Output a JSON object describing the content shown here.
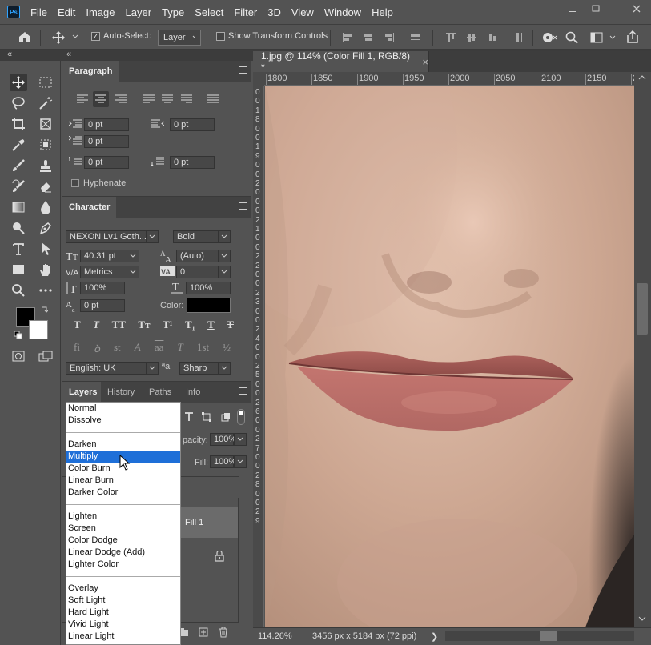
{
  "app": {
    "logo": "Ps",
    "accent": "#31a8ff"
  },
  "menubar": {
    "items": [
      "File",
      "Edit",
      "Image",
      "Layer",
      "Type",
      "Select",
      "Filter",
      "3D",
      "View",
      "Window",
      "Help"
    ]
  },
  "options": {
    "auto_select_label": "Auto-Select:",
    "auto_select_checked": true,
    "auto_select_target": "Layer",
    "show_transform_label": "Show Transform Controls",
    "show_transform_checked": false
  },
  "collapse": {
    "left": "«",
    "right": "«"
  },
  "document": {
    "tab_title": "1.jpg @ 114% (Color Fill 1, RGB/8) *",
    "close": "×"
  },
  "ruler": {
    "h_labels": [
      "1800",
      "1850",
      "1900",
      "1950",
      "2000",
      "2050",
      "2100",
      "2150",
      "2"
    ],
    "v_labels": [
      "0",
      "0",
      "1",
      "8",
      "0",
      "0",
      "1",
      "9",
      "0",
      "0",
      "2",
      "0",
      "0",
      "0",
      "2",
      "1",
      "0",
      "0",
      "2",
      "2",
      "0",
      "0",
      "2",
      "3",
      "0",
      "0",
      "2",
      "4",
      "0",
      "0",
      "2",
      "5",
      "0",
      "0",
      "2",
      "6",
      "0",
      "0",
      "2",
      "7",
      "0",
      "0",
      "2",
      "8",
      "0",
      "0",
      "2",
      "9"
    ]
  },
  "paragraph": {
    "tab": "Paragraph",
    "indent_left": "0 pt",
    "indent_right": "0 pt",
    "first_line": "0 pt",
    "space_before": "0 pt",
    "space_after": "0 pt",
    "hyphenate_label": "Hyphenate"
  },
  "character": {
    "tab": "Character",
    "font_family": "NEXON Lv1 Goth...",
    "font_style": "Bold",
    "size": "40.31 pt",
    "leading": "(Auto)",
    "kerning": "Metrics",
    "tracking": "0",
    "vscale": "100%",
    "hscale": "100%",
    "baseline": "0 pt",
    "color_label": "Color:",
    "color": "#000000",
    "language": "English: UK",
    "aa_glyph": "ªa",
    "antialias": "Sharp",
    "style_glyphs": [
      "T",
      "T",
      "TT",
      "Tт",
      "T¹",
      "T₁",
      "T",
      "T"
    ],
    "ot_glyphs": [
      "fi",
      "ꝺ",
      "st",
      "A",
      "aa",
      "T",
      "1st",
      "½"
    ]
  },
  "layers": {
    "tabs": [
      "Layers",
      "History",
      "Paths",
      "Info"
    ],
    "opacity_label": "pacity:",
    "opacity": "100%",
    "fill_label": "Fill:",
    "fill": "100%",
    "layer_name": "Fill 1"
  },
  "blend_modes": {
    "groups": [
      [
        "Normal",
        "Dissolve"
      ],
      [
        "Darken",
        "Multiply",
        "Color Burn",
        "Linear Burn",
        "Darker Color"
      ],
      [
        "Lighten",
        "Screen",
        "Color Dodge",
        "Linear Dodge (Add)",
        "Lighter Color"
      ],
      [
        "Overlay",
        "Soft Light",
        "Hard Light",
        "Vivid Light",
        "Linear Light"
      ]
    ],
    "highlighted": "Multiply",
    "highlight_color": "#1e6fd8"
  },
  "status": {
    "zoom": "114.26%",
    "dimensions": "3456 px x 5184 px (72 ppi)",
    "arrow": "❯"
  }
}
